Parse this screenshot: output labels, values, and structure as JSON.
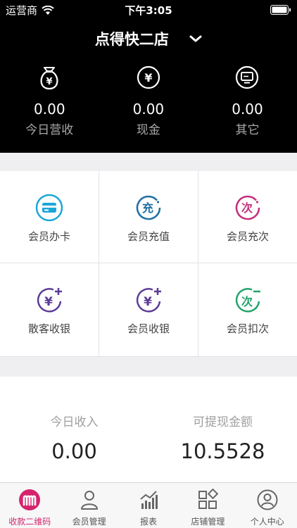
{
  "status_bar": {
    "carrier": "运营商",
    "time": "下午3:05"
  },
  "header": {
    "store_name": "点得快二店"
  },
  "summary": [
    {
      "label": "今日营收",
      "value": "0.00",
      "icon": "money-bag-icon"
    },
    {
      "label": "现金",
      "value": "0.00",
      "icon": "yen-circle-icon"
    },
    {
      "label": "其它",
      "value": "0.00",
      "icon": "monitor-icon"
    }
  ],
  "grid": [
    {
      "label": "会员办卡",
      "icon": "card-icon",
      "color": "#1aa7d8"
    },
    {
      "label": "会员充值",
      "icon_text": "充",
      "color": "#1f6fa3"
    },
    {
      "label": "会员充次",
      "icon_text": "次",
      "color": "#c4307b"
    },
    {
      "label": "散客收银",
      "icon": "yen-plus-icon",
      "color": "#5b3c96"
    },
    {
      "label": "会员收银",
      "icon": "yen-plus-icon",
      "color": "#5b3c96"
    },
    {
      "label": "会员扣次",
      "icon_text": "次",
      "color": "#22a36a"
    }
  ],
  "income": {
    "today_label": "今日收入",
    "today_value": "0.00",
    "withdraw_label": "可提现金额",
    "withdraw_value": "10.5528"
  },
  "tabs": [
    {
      "label": "收款二维码",
      "icon": "m-logo-icon",
      "active": true
    },
    {
      "label": "会员管理",
      "icon": "person-icon"
    },
    {
      "label": "报表",
      "icon": "chart-icon"
    },
    {
      "label": "店铺管理",
      "icon": "grid-icon"
    },
    {
      "label": "个人中心",
      "icon": "profile-icon"
    }
  ],
  "colors": {
    "accent": "#d4246c",
    "header_bg": "#000000"
  }
}
